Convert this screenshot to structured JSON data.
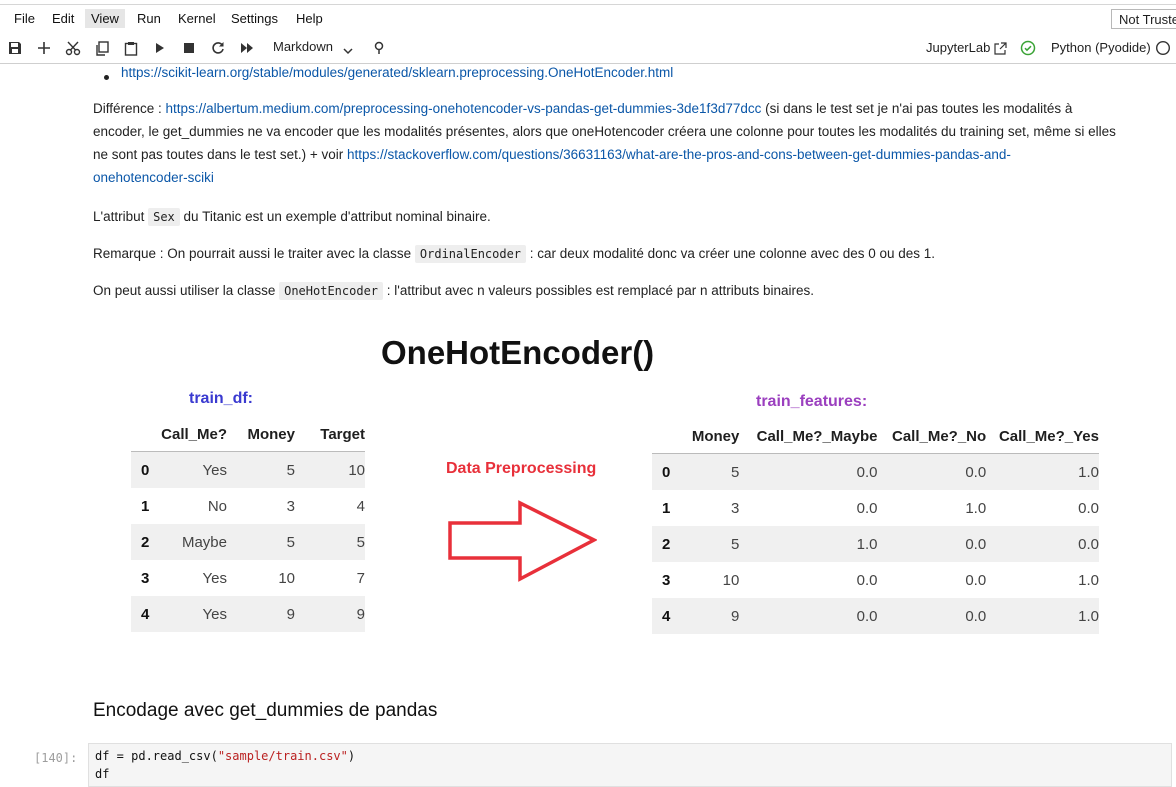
{
  "menu": [
    "File",
    "Edit",
    "View",
    "Run",
    "Kernel",
    "Settings",
    "Help"
  ],
  "menu_active": "View",
  "trust_status": "Not Trusted",
  "toolbar": {
    "icons": [
      "save-icon",
      "add-cell-icon",
      "cut-icon",
      "copy-icon",
      "paste-icon",
      "run-icon",
      "stop-icon",
      "restart-icon",
      "run-all-icon"
    ],
    "cell_type": "Markdown",
    "jupyterlab_label": "JupyterLab",
    "kernel_label": "Python (Pyodide)"
  },
  "notebook": {
    "bullet_link": "https://scikit-learn.org/stable/modules/generated/sklearn.preprocessing.OneHotEncoder.html",
    "diff_prefix": "Différence : ",
    "diff_link1": "https://albertum.medium.com/preprocessing-onehotencoder-vs-pandas-get-dummies-3de1f3d77dcc",
    "diff_text_a": " (si dans le test set je n'ai pas toutes les modalités à",
    "diff_text_b": "encoder, le get_dummies ne va encoder que les modalités présentes, alors que oneHotencoder créera une colonne pour toutes les modalités du training set, même si elles",
    "diff_text_c": "ne sont pas toutes dans le test set.) + voir ",
    "diff_link2a": "https://stackoverflow.com/questions/36631163/what-are-the-pros-and-cons-between-get-dummies-pandas-and-",
    "diff_link2b": "onehotencoder-sciki",
    "p_sex_a": "L'attribut ",
    "p_sex_code": "Sex",
    "p_sex_b": " du Titanic est un exemple d'attribut nominal binaire.",
    "p_rem_a": "Remarque : On pourrait aussi le traiter avec la classe ",
    "p_rem_code": "OrdinalEncoder",
    "p_rem_b": " : car deux modalité donc va créer une colonne avec des 0 ou des 1.",
    "p_ohe_a": "On peut aussi utiliser la classe ",
    "p_ohe_code": "OneHotEncoder",
    "p_ohe_b": " : l'attribut avec n valeurs possibles est remplacé par n attributs binaires.",
    "heading": "Encodage avec get_dummies de pandas",
    "code_prompt": "[140]:",
    "code_line1_a": "df = pd.read_csv(",
    "code_line1_str": "\"sample/train.csv\"",
    "code_line1_b": ")",
    "code_line2": "df"
  },
  "figure": {
    "title": "OneHotEncoder()",
    "left_label": "train_df:",
    "left_label_color": "#3a3ad0",
    "arrow_label": "Data Preprocessing",
    "arrow_color": "#e8303a",
    "right_label": "train_features:",
    "right_label_color": "#9b3fbf",
    "left_table": {
      "columns": [
        "",
        "Call_Me?",
        "Money",
        "Target"
      ],
      "rows": [
        [
          "0",
          "Yes",
          "5",
          "10"
        ],
        [
          "1",
          "No",
          "3",
          "4"
        ],
        [
          "2",
          "Maybe",
          "5",
          "5"
        ],
        [
          "3",
          "Yes",
          "10",
          "7"
        ],
        [
          "4",
          "Yes",
          "9",
          "9"
        ]
      ]
    },
    "right_table": {
      "columns": [
        "",
        "Money",
        "Call_Me?_Maybe",
        "Call_Me?_No",
        "Call_Me?_Yes"
      ],
      "rows": [
        [
          "0",
          "5",
          "0.0",
          "0.0",
          "1.0"
        ],
        [
          "1",
          "3",
          "0.0",
          "1.0",
          "0.0"
        ],
        [
          "2",
          "5",
          "1.0",
          "0.0",
          "0.0"
        ],
        [
          "3",
          "10",
          "0.0",
          "0.0",
          "1.0"
        ],
        [
          "4",
          "9",
          "0.0",
          "0.0",
          "1.0"
        ]
      ]
    }
  }
}
